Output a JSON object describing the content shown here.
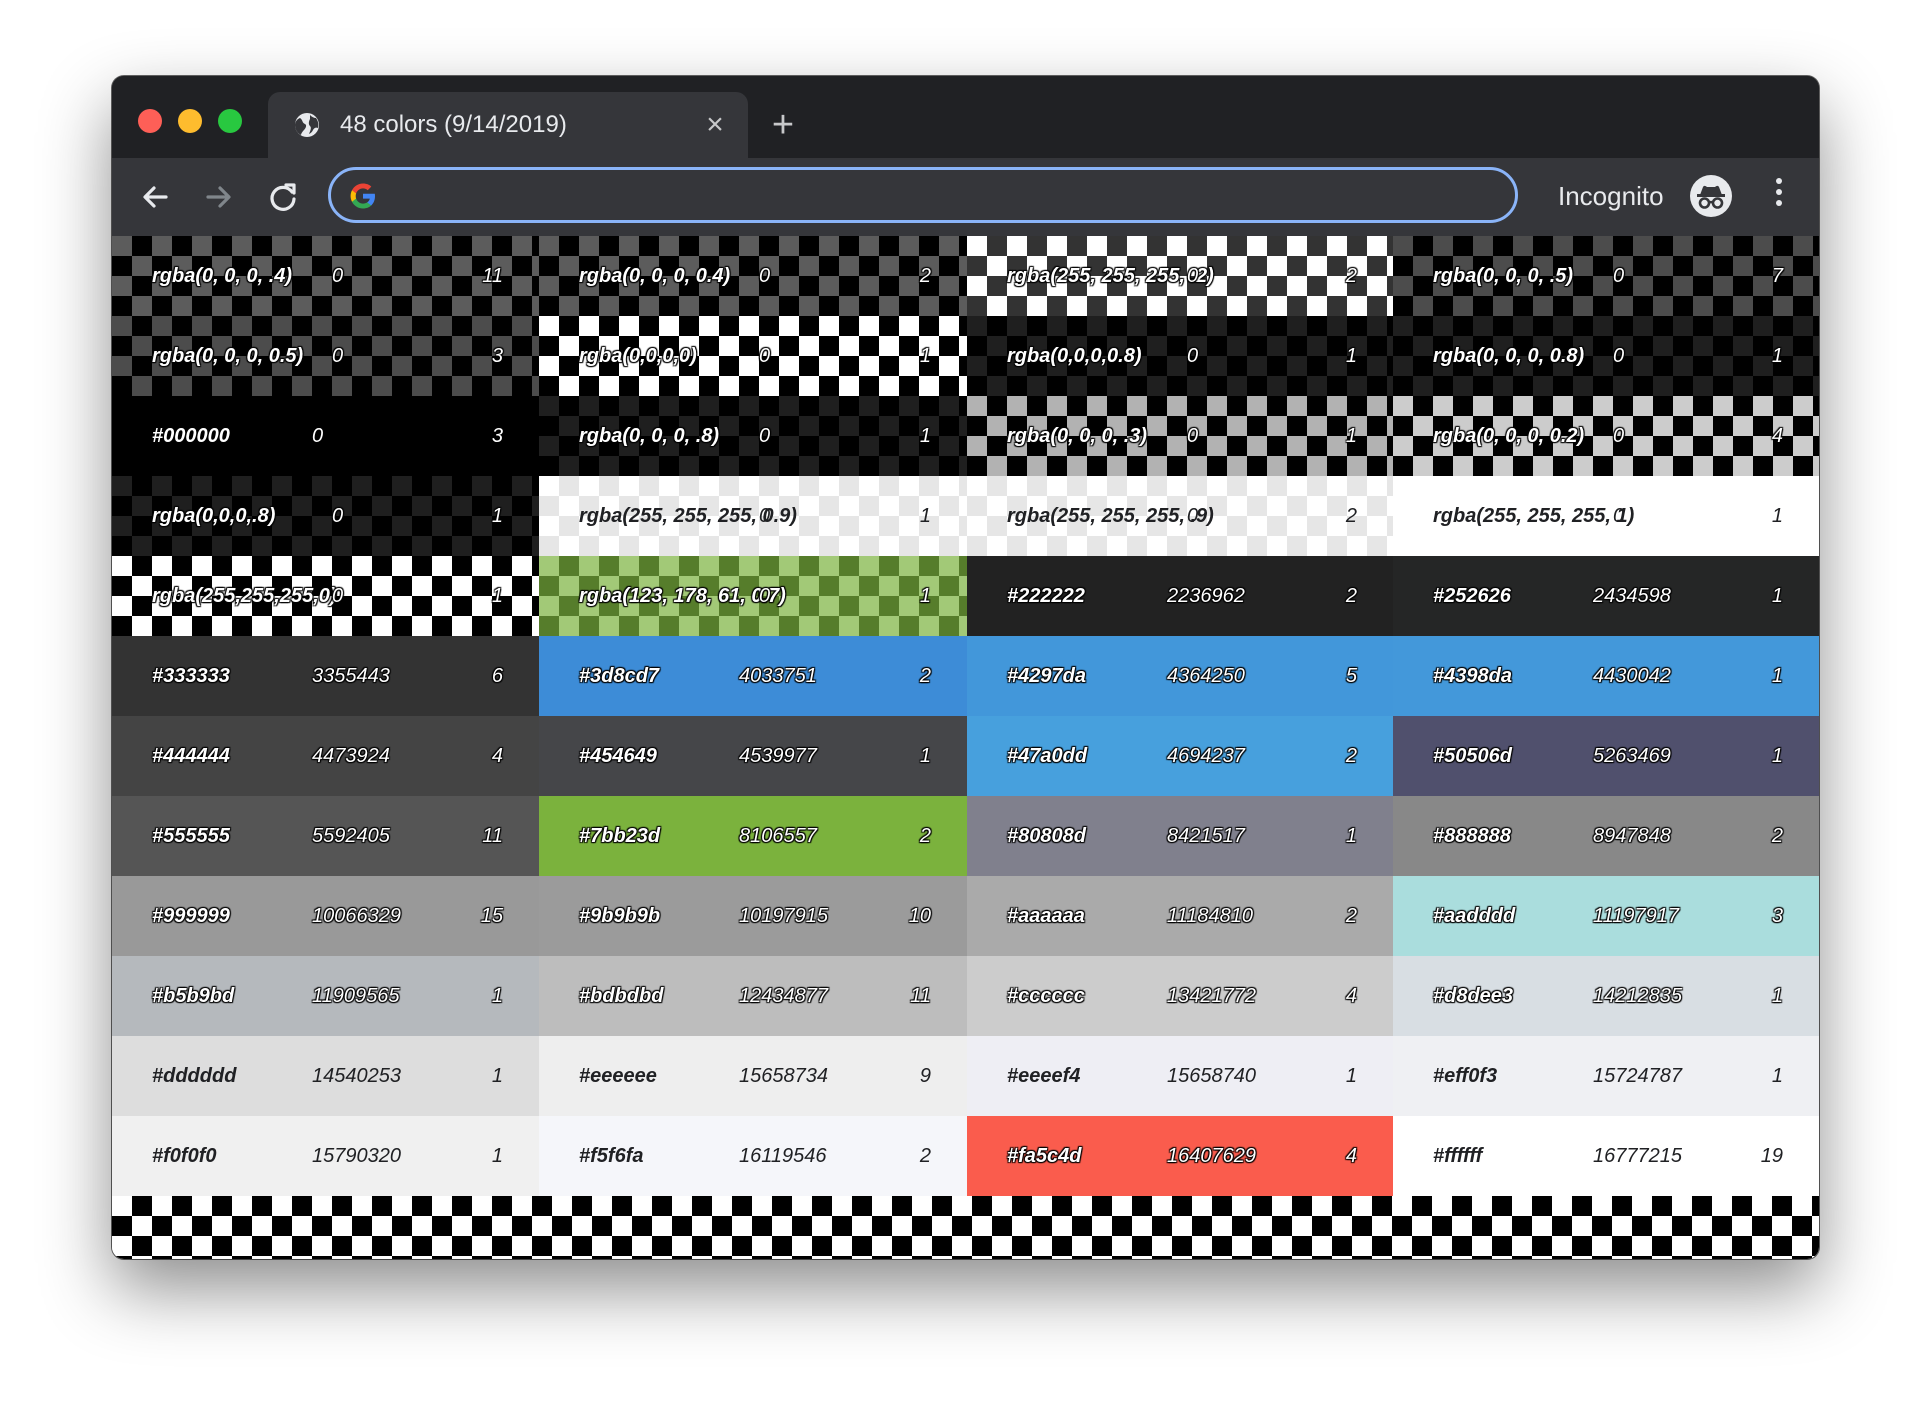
{
  "browser": {
    "tab_title": "48 colors (9/14/2019)",
    "tab_close": "×",
    "new_tab": "+",
    "omnibox_value": "",
    "incognito_label": "Incognito"
  },
  "cells": [
    {
      "label": "rgba(0, 0, 0, .4)",
      "number": "0",
      "count": "11",
      "base": "#999999",
      "overlay": "rgba(0,0,0,.4)",
      "check": true
    },
    {
      "label": "rgba(0, 0, 0, 0.4)",
      "number": "0",
      "count": "2",
      "base": "#999999",
      "overlay": "rgba(0,0,0,.4)",
      "check": true
    },
    {
      "label": "rgba(255, 255, 255, .2)",
      "number": "0",
      "count": "2",
      "base": "#ffffff",
      "overlay": "rgba(255,255,255,.2)",
      "check": true
    },
    {
      "label": "rgba(0, 0, 0, .5)",
      "number": "0",
      "count": "7",
      "base": "#999999",
      "overlay": "rgba(0,0,0,.5)",
      "check": true
    },
    {
      "label": "rgba(0, 0, 0, 0.5)",
      "number": "0",
      "count": "3",
      "base": "#999999",
      "overlay": "rgba(0,0,0,.5)",
      "check": true
    },
    {
      "label": "rgba(0,0,0,0)",
      "number": "0",
      "count": "1",
      "base": "#ffffff",
      "overlay": "rgba(0,0,0,0)",
      "check": true
    },
    {
      "label": "rgba(0,0,0,0.8)",
      "number": "0",
      "count": "1",
      "base": "#999999",
      "overlay": "rgba(0,0,0,.8)",
      "check": true
    },
    {
      "label": "rgba(0, 0, 0, 0.8)",
      "number": "0",
      "count": "1",
      "base": "#999999",
      "overlay": "rgba(0,0,0,.8)",
      "check": true
    },
    {
      "label": "#000000",
      "number": "0",
      "count": "3",
      "base": "#000000",
      "overlay": "transparent",
      "check": false
    },
    {
      "label": "rgba(0, 0, 0, .8)",
      "number": "0",
      "count": "1",
      "base": "#999999",
      "overlay": "rgba(0,0,0,.8)",
      "check": true
    },
    {
      "label": "rgba(0, 0, 0, .3)",
      "number": "0",
      "count": "1",
      "base": "#ffffff",
      "overlay": "rgba(0,0,0,.3)",
      "check": true
    },
    {
      "label": "rgba(0, 0, 0, 0.2)",
      "number": "0",
      "count": "4",
      "base": "#ffffff",
      "overlay": "rgba(0,0,0,.2)",
      "check": true
    },
    {
      "label": "rgba(0,0,0,.8)",
      "number": "0",
      "count": "1",
      "base": "#999999",
      "overlay": "rgba(0,0,0,.8)",
      "check": true
    },
    {
      "label": "rgba(255, 255, 255, 0.9)",
      "number": "0",
      "count": "1",
      "base": "#ffffff",
      "overlay": "rgba(255,255,255,.9)",
      "check": true,
      "dark": true
    },
    {
      "label": "rgba(255, 255, 255, .9)",
      "number": "0",
      "count": "2",
      "base": "#ffffff",
      "overlay": "rgba(255,255,255,.9)",
      "check": true,
      "dark": true
    },
    {
      "label": "rgba(255, 255, 255, 1)",
      "number": "0",
      "count": "1",
      "base": "#ffffff",
      "overlay": "#ffffff",
      "check": false,
      "dark": true
    },
    {
      "label": "rgba(255,255,255,0)",
      "number": "0",
      "count": "1",
      "base": "#ffffff",
      "overlay": "rgba(255,255,255,0)",
      "check": true
    },
    {
      "label": "rgba(123, 178, 61, 0.7)",
      "number": "0",
      "count": "1",
      "base": "#ffffff",
      "overlay": "rgba(123,178,61,.7)",
      "check": true
    },
    {
      "label": "#222222",
      "number": "2236962",
      "count": "2",
      "base": "#222222",
      "overlay": "transparent",
      "check": false
    },
    {
      "label": "#252626",
      "number": "2434598",
      "count": "1",
      "base": "#252626",
      "overlay": "transparent",
      "check": false
    },
    {
      "label": "#333333",
      "number": "3355443",
      "count": "6",
      "base": "#333333",
      "overlay": "transparent",
      "check": false
    },
    {
      "label": "#3d8cd7",
      "number": "4033751",
      "count": "2",
      "base": "#3d8cd7",
      "overlay": "transparent",
      "check": false
    },
    {
      "label": "#4297da",
      "number": "4364250",
      "count": "5",
      "base": "#4297da",
      "overlay": "transparent",
      "check": false
    },
    {
      "label": "#4398da",
      "number": "4430042",
      "count": "1",
      "base": "#4398da",
      "overlay": "transparent",
      "check": false
    },
    {
      "label": "#444444",
      "number": "4473924",
      "count": "4",
      "base": "#444444",
      "overlay": "transparent",
      "check": false
    },
    {
      "label": "#454649",
      "number": "4539977",
      "count": "1",
      "base": "#454649",
      "overlay": "transparent",
      "check": false
    },
    {
      "label": "#47a0dd",
      "number": "4694237",
      "count": "2",
      "base": "#47a0dd",
      "overlay": "transparent",
      "check": false
    },
    {
      "label": "#50506d",
      "number": "5263469",
      "count": "1",
      "base": "#50506d",
      "overlay": "transparent",
      "check": false
    },
    {
      "label": "#555555",
      "number": "5592405",
      "count": "11",
      "base": "#555555",
      "overlay": "transparent",
      "check": false
    },
    {
      "label": "#7bb23d",
      "number": "8106557",
      "count": "2",
      "base": "#7bb23d",
      "overlay": "transparent",
      "check": false
    },
    {
      "label": "#80808d",
      "number": "8421517",
      "count": "1",
      "base": "#80808d",
      "overlay": "transparent",
      "check": false
    },
    {
      "label": "#888888",
      "number": "8947848",
      "count": "2",
      "base": "#888888",
      "overlay": "transparent",
      "check": false
    },
    {
      "label": "#999999",
      "number": "10066329",
      "count": "15",
      "base": "#999999",
      "overlay": "transparent",
      "check": false
    },
    {
      "label": "#9b9b9b",
      "number": "10197915",
      "count": "10",
      "base": "#9b9b9b",
      "overlay": "transparent",
      "check": false
    },
    {
      "label": "#aaaaaa",
      "number": "11184810",
      "count": "2",
      "base": "#aaaaaa",
      "overlay": "transparent",
      "check": false
    },
    {
      "label": "#aadddd",
      "number": "11197917",
      "count": "3",
      "base": "#aadddd",
      "overlay": "transparent",
      "check": false
    },
    {
      "label": "#b5b9bd",
      "number": "11909565",
      "count": "1",
      "base": "#b5b9bd",
      "overlay": "transparent",
      "check": false
    },
    {
      "label": "#bdbdbd",
      "number": "12434877",
      "count": "11",
      "base": "#bdbdbd",
      "overlay": "transparent",
      "check": false
    },
    {
      "label": "#cccccc",
      "number": "13421772",
      "count": "4",
      "base": "#cccccc",
      "overlay": "transparent",
      "check": false
    },
    {
      "label": "#d8dee3",
      "number": "14212835",
      "count": "1",
      "base": "#d8dee3",
      "overlay": "transparent",
      "check": false
    },
    {
      "label": "#dddddd",
      "number": "14540253",
      "count": "1",
      "base": "#dddddd",
      "overlay": "transparent",
      "check": false,
      "dark": true
    },
    {
      "label": "#eeeeee",
      "number": "15658734",
      "count": "9",
      "base": "#eeeeee",
      "overlay": "transparent",
      "check": false,
      "dark": true
    },
    {
      "label": "#eeeef4",
      "number": "15658740",
      "count": "1",
      "base": "#eeeef4",
      "overlay": "transparent",
      "check": false,
      "dark": true
    },
    {
      "label": "#eff0f3",
      "number": "15724787",
      "count": "1",
      "base": "#eff0f3",
      "overlay": "transparent",
      "check": false,
      "dark": true
    },
    {
      "label": "#f0f0f0",
      "number": "15790320",
      "count": "1",
      "base": "#f0f0f0",
      "overlay": "transparent",
      "check": false,
      "dark": true
    },
    {
      "label": "#f5f6fa",
      "number": "16119546",
      "count": "2",
      "base": "#f5f6fa",
      "overlay": "transparent",
      "check": false,
      "dark": true
    },
    {
      "label": "#fa5c4d",
      "number": "16407629",
      "count": "4",
      "base": "#fa5c4d",
      "overlay": "transparent",
      "check": false
    },
    {
      "label": "#ffffff",
      "number": "16777215",
      "count": "19",
      "base": "#ffffff",
      "overlay": "transparent",
      "check": false,
      "dark": true
    }
  ]
}
